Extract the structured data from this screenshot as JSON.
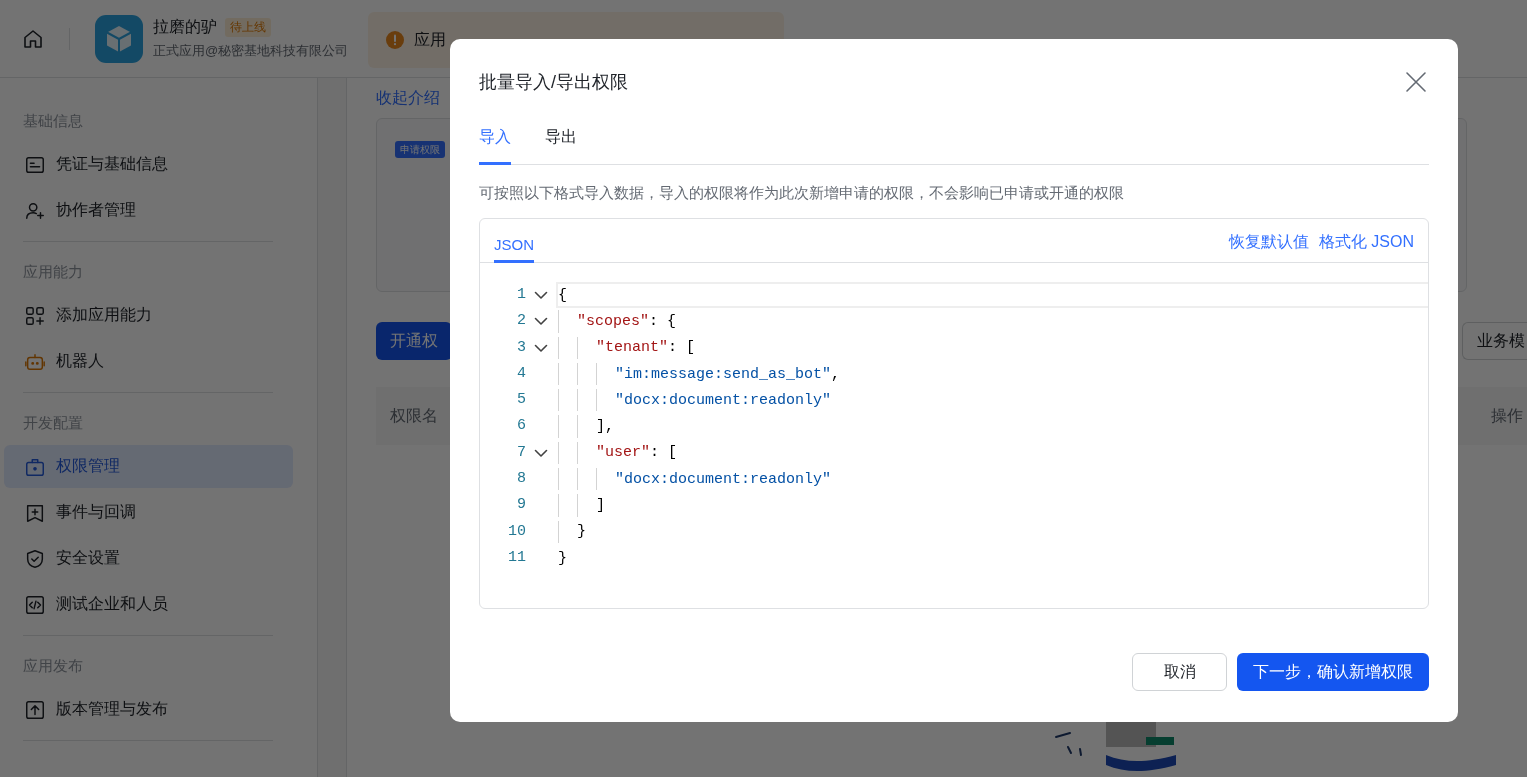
{
  "header": {
    "app_name": "拉磨的驴",
    "badge": "待上线",
    "subtitle": "正式应用@秘密基地科技有限公司",
    "notice": {
      "text": "应用"
    }
  },
  "sidebar": {
    "sections": [
      {
        "title": "基础信息",
        "items": [
          {
            "label": "凭证与基础信息",
            "selected": false
          },
          {
            "label": "协作者管理",
            "selected": false
          }
        ]
      },
      {
        "title": "应用能力",
        "items": [
          {
            "label": "添加应用能力",
            "selected": false
          },
          {
            "label": "机器人",
            "selected": false
          }
        ]
      },
      {
        "title": "开发配置",
        "items": [
          {
            "label": "权限管理",
            "selected": true
          },
          {
            "label": "事件与回调",
            "selected": false
          },
          {
            "label": "安全设置",
            "selected": false
          },
          {
            "label": "测试企业和人员",
            "selected": false
          }
        ]
      },
      {
        "title": "应用发布",
        "items": [
          {
            "label": "版本管理与发布",
            "selected": false
          }
        ]
      }
    ]
  },
  "main": {
    "collapse_link": "收起介绍",
    "intro_badge": "申请权限",
    "open_button": "开通权",
    "filter_button": "业务模",
    "table": {
      "columns": [
        "权限名",
        "操作"
      ]
    }
  },
  "dialog": {
    "title": "批量导入/导出权限",
    "tabs": [
      {
        "label": "导入",
        "selected": true
      },
      {
        "label": "导出",
        "selected": false
      }
    ],
    "description": "可按照以下格式导入数据，导入的权限将作为此次新增申请的权限，不会影响已申请或开通的权限",
    "editor": {
      "tab": "JSON",
      "actions": [
        "恢复默认值",
        "格式化 JSON"
      ],
      "lines": [
        {
          "number": "1",
          "code": "{",
          "expanded": true,
          "current": true
        },
        {
          "number": "2",
          "code": "  \"scopes\": {",
          "expanded": true,
          "current": false
        },
        {
          "number": "3",
          "code": "    \"tenant\": [",
          "expanded": true,
          "current": false
        },
        {
          "number": "4",
          "code": "      \"im:message:send_as_bot\",",
          "current": false
        },
        {
          "number": "5",
          "code": "      \"docx:document:readonly\"",
          "current": false
        },
        {
          "number": "6",
          "code": "    ],",
          "current": false
        },
        {
          "number": "7",
          "code": "    \"user\": [",
          "expanded": true,
          "current": false
        },
        {
          "number": "8",
          "code": "      \"docx:document:readonly\"",
          "current": false
        },
        {
          "number": "9",
          "code": "    ]",
          "current": false
        },
        {
          "number": "10",
          "code": "  }",
          "current": false
        },
        {
          "number": "11",
          "code": "}",
          "current": false
        }
      ]
    },
    "buttons": [
      {
        "label": "取消",
        "kind": "secondary"
      },
      {
        "label": "下一步，确认新增权限",
        "kind": "primary"
      }
    ]
  }
}
